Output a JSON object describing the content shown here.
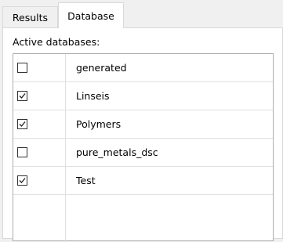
{
  "tabs": {
    "results_label": "Results",
    "database_label": "Database"
  },
  "panel": {
    "label": "Active databases:"
  },
  "databases": [
    {
      "name": "generated",
      "checked": false
    },
    {
      "name": "Linseis",
      "checked": true
    },
    {
      "name": "Polymers",
      "checked": true
    },
    {
      "name": "pure_metals_dsc",
      "checked": false
    },
    {
      "name": "Test",
      "checked": true
    }
  ],
  "icons": {
    "checked": "checkmark-icon"
  }
}
